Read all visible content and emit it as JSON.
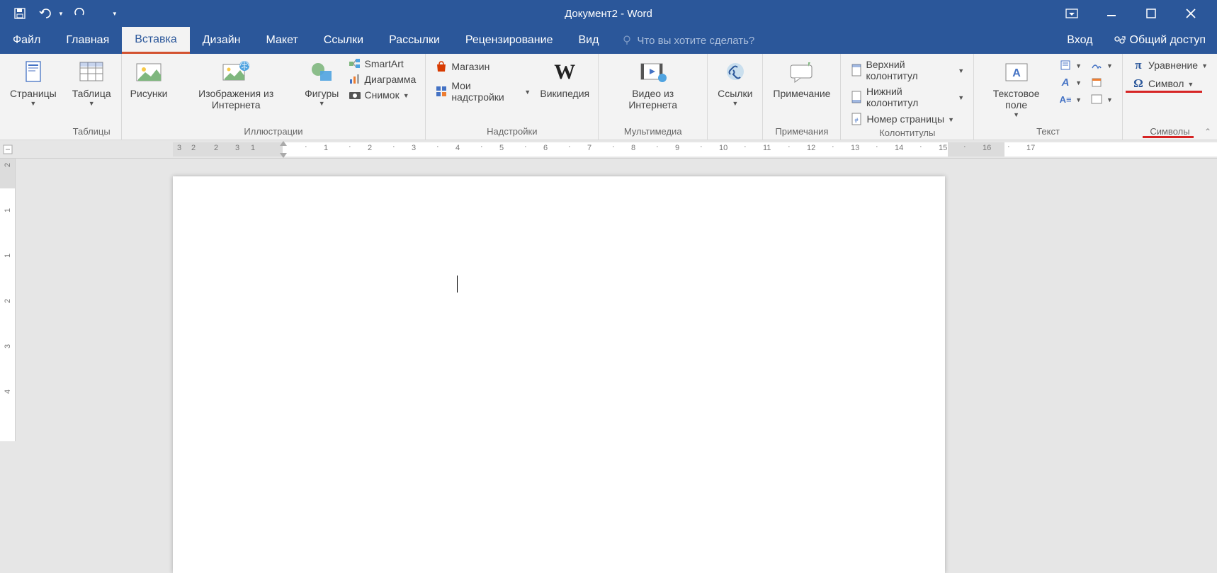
{
  "title": "Документ2 - Word",
  "qat": {
    "save": "save",
    "undo": "undo",
    "redo": "redo"
  },
  "tabs": [
    "Файл",
    "Главная",
    "Вставка",
    "Дизайн",
    "Макет",
    "Ссылки",
    "Рассылки",
    "Рецензирование",
    "Вид"
  ],
  "active_tab": 2,
  "tell_me": "Что вы хотите сделать?",
  "signin": "Вход",
  "share": "Общий доступ",
  "groups": {
    "pages": {
      "btn": "Страницы",
      "label": ""
    },
    "tables": {
      "btn": "Таблица",
      "label": "Таблицы"
    },
    "illustrations": {
      "label": "Иллюстрации",
      "pictures": "Рисунки",
      "online_pics": "Изображения из Интернета",
      "shapes": "Фигуры",
      "smartart": "SmartArt",
      "chart": "Диаграмма",
      "screenshot": "Снимок"
    },
    "addins": {
      "label": "Надстройки",
      "store": "Магазин",
      "myaddins": "Мои надстройки",
      "wikipedia": "Википедия"
    },
    "media": {
      "label": "Мультимедиа",
      "video": "Видео из Интернета"
    },
    "links": {
      "label": "",
      "link": "Ссылки"
    },
    "comments": {
      "label": "Примечания",
      "comment": "Примечание"
    },
    "headerfooter": {
      "label": "Колонтитулы",
      "header": "Верхний колонтитул",
      "footer": "Нижний колонтитул",
      "pagenum": "Номер страницы"
    },
    "text": {
      "label": "Текст",
      "textbox": "Текстовое поле"
    },
    "symbols": {
      "label": "Символы",
      "equation": "Уравнение",
      "symbol": "Символ"
    }
  },
  "ruler_numbers_left": [
    "3",
    "2",
    "1"
  ],
  "ruler_numbers_right": [
    "1",
    "2",
    "3",
    "4",
    "5",
    "6",
    "7",
    "8",
    "9",
    "10",
    "11",
    "12",
    "13",
    "14",
    "15",
    "16",
    "17"
  ],
  "v_ruler": [
    "2",
    "1",
    "1",
    "2",
    "3",
    "4"
  ]
}
